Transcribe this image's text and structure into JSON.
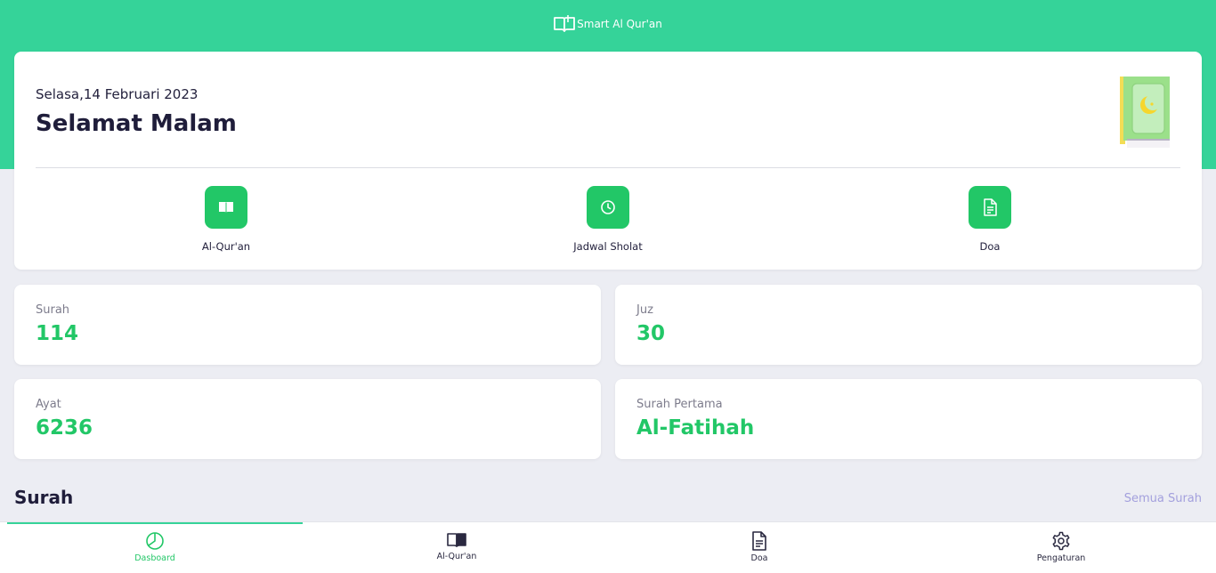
{
  "app": {
    "title": "Smart Al Qur'an"
  },
  "hero": {
    "date": "Selasa,14 Februari 2023",
    "greeting": "Selamat Malam"
  },
  "shortcuts": [
    {
      "label": "Al-Qur'an",
      "icon": "open-book-icon"
    },
    {
      "label": "Jadwal Sholat",
      "icon": "clock-icon"
    },
    {
      "label": "Doa",
      "icon": "document-icon"
    }
  ],
  "stats": [
    {
      "label": "Surah",
      "value": "114"
    },
    {
      "label": "Juz",
      "value": "30"
    },
    {
      "label": "Ayat",
      "value": "6236"
    },
    {
      "label": "Surah Pertama",
      "value": "Al-Fatihah"
    }
  ],
  "surah_section": {
    "title": "Surah",
    "see_all": "Semua Surah"
  },
  "bottom_nav": [
    {
      "label": "Dasboard",
      "icon": "pie-chart-icon",
      "active": true
    },
    {
      "label": "Al-Qur'an",
      "icon": "open-book-icon",
      "active": false
    },
    {
      "label": "Doa",
      "icon": "document-icon",
      "active": false
    },
    {
      "label": "Pengaturan",
      "icon": "gear-icon",
      "active": false
    }
  ],
  "colors": {
    "brand": "#35d399",
    "accent": "#22c767",
    "link": "#a3a0dd",
    "background": "#ecedf3"
  }
}
